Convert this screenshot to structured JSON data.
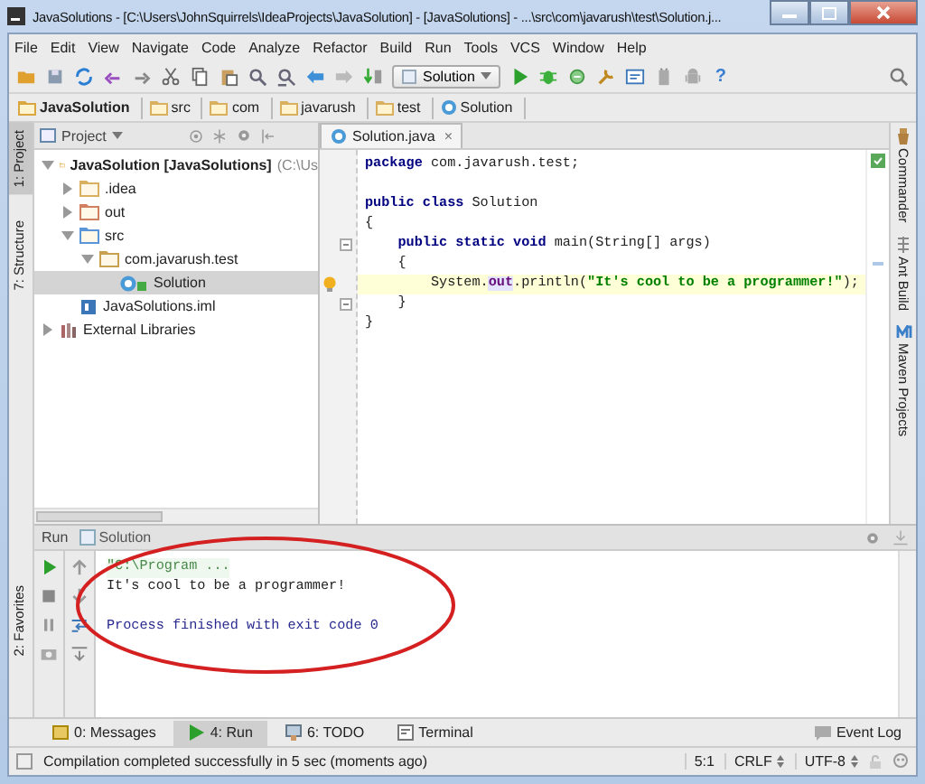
{
  "window": {
    "title": "JavaSolutions - [C:\\Users\\JohnSquirrels\\IdeaProjects\\JavaSolution] - [JavaSolutions] - ...\\src\\com\\javarush\\test\\Solution.j..."
  },
  "menu": [
    "File",
    "Edit",
    "View",
    "Navigate",
    "Code",
    "Analyze",
    "Refactor",
    "Build",
    "Run",
    "Tools",
    "VCS",
    "Window",
    "Help"
  ],
  "toolbar": {
    "run_config": "Solution",
    "help_label": "?"
  },
  "breadcrumbs": [
    {
      "label": "JavaSolution",
      "kind": "project"
    },
    {
      "label": "src",
      "kind": "folder"
    },
    {
      "label": "com",
      "kind": "folder"
    },
    {
      "label": "javarush",
      "kind": "folder"
    },
    {
      "label": "test",
      "kind": "folder"
    },
    {
      "label": "Solution",
      "kind": "class"
    }
  ],
  "left_strip": {
    "top": [
      {
        "label": "1: Project",
        "selected": true
      },
      {
        "label": "7: Structure",
        "selected": false
      }
    ],
    "bottom": [
      {
        "label": "2: Favorites",
        "selected": false
      }
    ]
  },
  "project_panel": {
    "view": "Project"
  },
  "tree": [
    {
      "label": "JavaSolution [JavaSolutions]",
      "hint": "(C:\\Us",
      "kind": "module",
      "expanded": true,
      "selected": false,
      "children": [
        {
          "label": ".idea",
          "kind": "folder",
          "expanded": false,
          "selected": false
        },
        {
          "label": "out",
          "kind": "out",
          "expanded": false,
          "selected": false
        },
        {
          "label": "src",
          "kind": "source",
          "expanded": true,
          "selected": false,
          "children": [
            {
              "label": "com.javarush.test",
              "kind": "package",
              "expanded": true,
              "selected": false,
              "children": [
                {
                  "label": "Solution",
                  "kind": "class",
                  "selected": true
                }
              ]
            }
          ]
        },
        {
          "label": "JavaSolutions.iml",
          "kind": "iml",
          "selected": false
        }
      ]
    },
    {
      "label": "External Libraries",
      "kind": "library",
      "expanded": false,
      "selected": false
    }
  ],
  "editor": {
    "tab": {
      "label": "Solution.java",
      "close": "×"
    },
    "lines": [
      {
        "current": false,
        "fold": false,
        "tokens": [
          {
            "t": "package ",
            "kind": "kw"
          },
          {
            "t": "com.javarush.test;",
            "kind": "plain"
          }
        ]
      },
      {
        "current": false,
        "fold": false
      },
      {
        "current": false,
        "fold": false,
        "tokens": [
          {
            "t": "public class ",
            "kind": "kw"
          },
          {
            "t": "Solution",
            "kind": "plain"
          }
        ]
      },
      {
        "current": false,
        "fold": false,
        "tokens": [
          {
            "t": "{",
            "kind": "plain"
          }
        ]
      },
      {
        "current": false,
        "fold": true,
        "tokens": [
          {
            "t": "    public static void ",
            "kind": "kw"
          },
          {
            "t": "main(String[] args)",
            "kind": "plain"
          }
        ]
      },
      {
        "current": false,
        "fold": false,
        "tokens": [
          {
            "t": "    {",
            "kind": "plain"
          }
        ]
      },
      {
        "current": true,
        "fold": false,
        "tokens": [
          {
            "t": "        System.",
            "kind": "plain"
          },
          {
            "t": "out",
            "kind": "field"
          },
          {
            "t": ".println(",
            "kind": "plain"
          },
          {
            "t": "\"It's cool to be a programmer!\"",
            "kind": "str"
          },
          {
            "t": ");",
            "kind": "plain"
          }
        ]
      },
      {
        "current": false,
        "fold": true,
        "tokens": [
          {
            "t": "    }",
            "kind": "plain"
          }
        ]
      },
      {
        "current": false,
        "fold": false,
        "tokens": [
          {
            "t": "}",
            "kind": "plain"
          }
        ]
      }
    ]
  },
  "right_strip": [
    {
      "label": "Commander",
      "kind": "commander"
    },
    {
      "label": "Ant Build",
      "kind": "ant"
    },
    {
      "label": "Maven Projects",
      "kind": "maven"
    }
  ],
  "run_panel": {
    "title": "Run",
    "tab": "Solution",
    "console": [
      {
        "text": "\"C:\\Program ...",
        "kind": "command"
      },
      {
        "text": "It's cool to be a programmer!",
        "kind": "output"
      },
      {
        "text": "Process finished with exit code 0",
        "kind": "system"
      }
    ]
  },
  "tool_tabs": [
    {
      "label": "0: Messages",
      "kind": "messages",
      "selected": false
    },
    {
      "label": "4: Run",
      "kind": "run",
      "selected": true
    },
    {
      "label": "6: TODO",
      "kind": "todo",
      "selected": false
    },
    {
      "label": "Terminal",
      "kind": "terminal",
      "selected": false
    }
  ],
  "event_log": "Event Log",
  "status_bar": {
    "message": "Compilation completed successfully in 5 sec (moments ago)",
    "position": "5:1",
    "line_separator": "CRLF",
    "encoding": "UTF-8"
  }
}
